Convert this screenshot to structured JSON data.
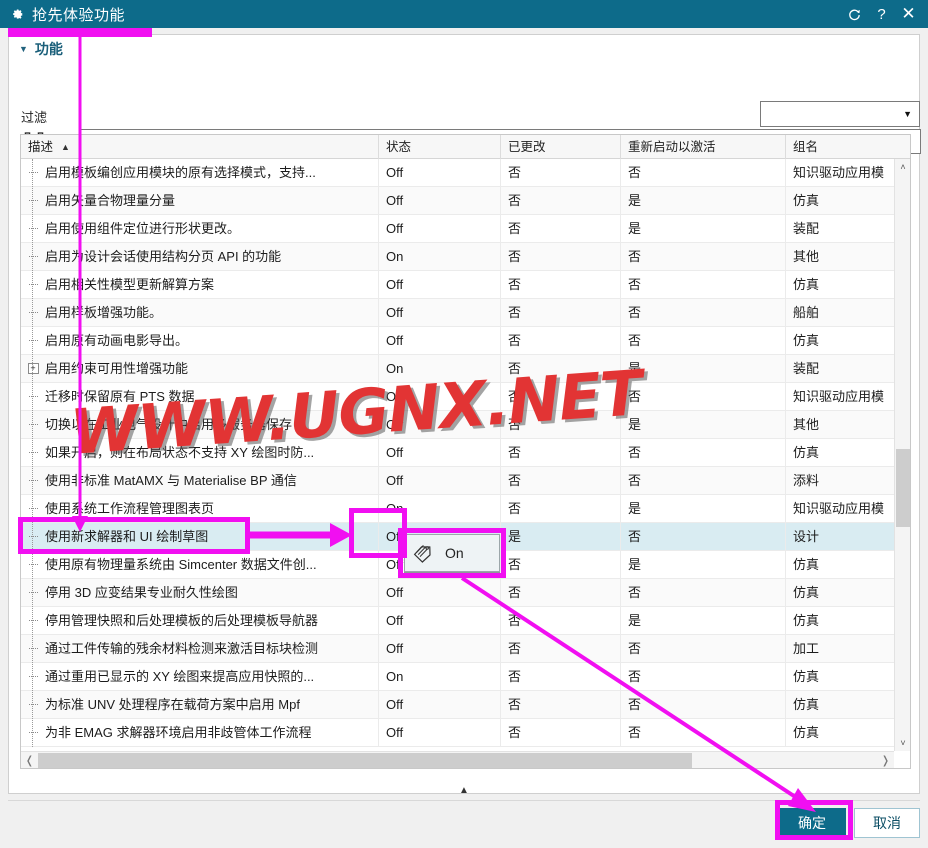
{
  "window": {
    "title": "抢先体验功能",
    "gear_icon": "gear-icon",
    "reset_icon": "reset-icon",
    "help_icon": "help-icon",
    "close_icon": "close-icon"
  },
  "section": {
    "caret": "▼",
    "title": "功能"
  },
  "filter": {
    "label": "过滤",
    "dropdown_value": "",
    "dropdown_arrow": "▼"
  },
  "find": {
    "icon": "binoculars-icon",
    "label": "查找",
    "value": "",
    "placeholder": ""
  },
  "table": {
    "columns": [
      {
        "key": "desc",
        "label": "描述",
        "sorted": true,
        "sort_arrow": "▲"
      },
      {
        "key": "state",
        "label": "状态"
      },
      {
        "key": "changed",
        "label": "已更改"
      },
      {
        "key": "restart",
        "label": "重新启动以激活"
      },
      {
        "key": "group",
        "label": "组名"
      }
    ],
    "rows": [
      {
        "desc": "启用模板编创应用模块的原有选择模式，支持...",
        "state": "Off",
        "changed": "否",
        "restart": "否",
        "group": "知识驱动应用模",
        "node": "dash"
      },
      {
        "desc": "启用矢量合物理量分量",
        "state": "Off",
        "changed": "否",
        "restart": "是",
        "group": "仿真",
        "node": "dash"
      },
      {
        "desc": "启用使用组件定位进行形状更改。",
        "state": "Off",
        "changed": "否",
        "restart": "是",
        "group": "装配",
        "node": "dash"
      },
      {
        "desc": "启用为设计会话使用结构分页 API 的功能",
        "state": "On",
        "changed": "否",
        "restart": "否",
        "group": "其他",
        "node": "dash"
      },
      {
        "desc": "启用相关性模型更新解算方案",
        "state": "Off",
        "changed": "否",
        "restart": "否",
        "group": "仿真",
        "node": "dash"
      },
      {
        "desc": "启用样板增强功能。",
        "state": "Off",
        "changed": "否",
        "restart": "否",
        "group": "船舶",
        "node": "dash"
      },
      {
        "desc": "启用原有动画电影导出。",
        "state": "Off",
        "changed": "否",
        "restart": "否",
        "group": "仿真",
        "node": "dash"
      },
      {
        "desc": "启用约束可用性增强功能",
        "state": "On",
        "changed": "否",
        "restart": "是",
        "group": "装配",
        "node": "expand"
      },
      {
        "desc": "迁移时保留原有 PTS 数据",
        "state": "Off",
        "changed": "否",
        "restart": "否",
        "group": "知识驱动应用模",
        "node": "dash"
      },
      {
        "desc": "切换以在工业电气设计中启用多服务器保存",
        "state": "Off",
        "changed": "否",
        "restart": "是",
        "group": "其他",
        "node": "dash"
      },
      {
        "desc": "如果开启，则在布局状态不支持 XY 绘图时防...",
        "state": "Off",
        "changed": "否",
        "restart": "否",
        "group": "仿真",
        "node": "dash"
      },
      {
        "desc": "使用非标准 MatAMX 与 Materialise BP 通信",
        "state": "Off",
        "changed": "否",
        "restart": "否",
        "group": "添料",
        "node": "dash"
      },
      {
        "desc": "使用系统工作流程管理图表页",
        "state": "On",
        "changed": "否",
        "restart": "是",
        "group": "知识驱动应用模",
        "node": "dash"
      },
      {
        "desc": "使用新求解器和 UI 绘制草图",
        "state": "Off",
        "changed": "是",
        "restart": "否",
        "group": "设计",
        "node": "dash",
        "selected": true
      },
      {
        "desc": "使用原有物理量系统由 Simcenter 数据文件创...",
        "state": "Off",
        "changed": "否",
        "restart": "是",
        "group": "仿真",
        "node": "dash"
      },
      {
        "desc": "停用 3D 应变结果专业耐久性绘图",
        "state": "Off",
        "changed": "否",
        "restart": "否",
        "group": "仿真",
        "node": "dash"
      },
      {
        "desc": "停用管理快照和后处理模板的后处理模板导航器",
        "state": "Off",
        "changed": "否",
        "restart": "是",
        "group": "仿真",
        "node": "dash"
      },
      {
        "desc": "通过工件传输的残余材料检测来激活目标块检测",
        "state": "Off",
        "changed": "否",
        "restart": "否",
        "group": "加工",
        "node": "dash"
      },
      {
        "desc": "通过重用已显示的 XY 绘图来提高应用快照的...",
        "state": "On",
        "changed": "否",
        "restart": "否",
        "group": "仿真",
        "node": "dash"
      },
      {
        "desc": "为标准 UNV 处理程序在载荷方案中启用 Mpf",
        "state": "Off",
        "changed": "否",
        "restart": "否",
        "group": "仿真",
        "node": "dash"
      },
      {
        "desc": "为非 EMAG 求解器环境启用非歧管体工作流程",
        "state": "Off",
        "changed": "否",
        "restart": "否",
        "group": "仿真",
        "node": "dash"
      }
    ]
  },
  "tooltip": {
    "icon": "tag-icon",
    "text": "On"
  },
  "scrollbars": {
    "v_up": "˄",
    "v_down": "˅",
    "h_left": "❬",
    "h_right": "❭"
  },
  "collapse_strip": {
    "chevron": "▲"
  },
  "footer": {
    "ok_label": "确定",
    "cancel_label": "取消"
  },
  "watermark": {
    "text": "WWW.UGNX.NET"
  },
  "colors": {
    "title_bar": "#0d6b8a",
    "accent_magenta": "#f10ff1",
    "selected_row": "#d9ecf2",
    "ok_button": "#0d6b8a",
    "watermark_red": "#e23434"
  }
}
